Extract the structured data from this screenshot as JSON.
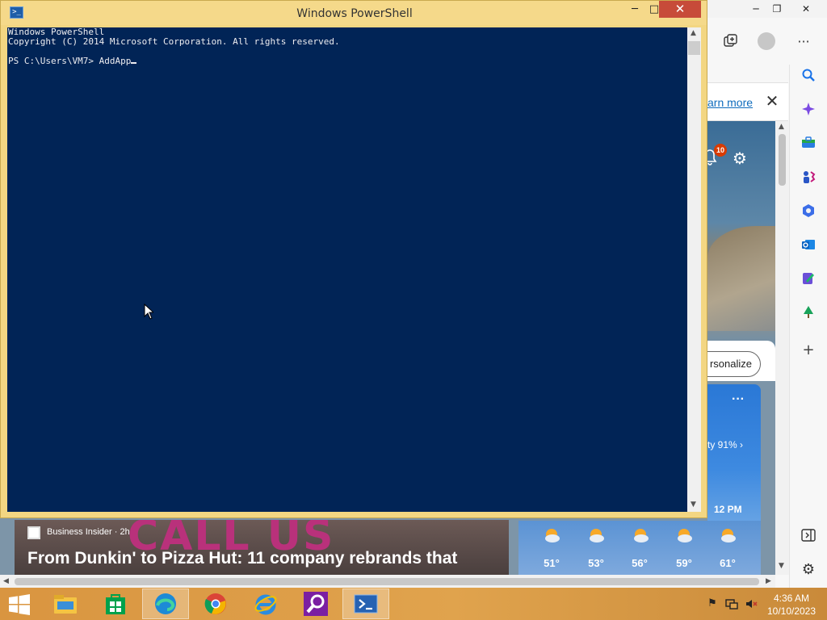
{
  "browser": {
    "window_controls": {
      "minimize": "─",
      "maximize": "❐",
      "close": "✕"
    },
    "toolbar": {
      "more": "···"
    },
    "infobar": {
      "learn_more": "arn more",
      "close": "✕"
    },
    "notification_count": "10",
    "personalize_label": "rsonalize",
    "weather": {
      "more": "···",
      "humidity": "ty 91% ›",
      "time_label": "12 PM",
      "forecast": [
        "51°",
        "53°",
        "56°",
        "59°",
        "61°"
      ]
    },
    "news": {
      "image_text": "CALL US",
      "source": "Business Insider · 2h",
      "title": "From Dunkin' to Pizza Hut: 11 company rebrands that"
    }
  },
  "powershell": {
    "title": "Windows PowerShell",
    "controls": {
      "minimize": "─",
      "maximize": "□",
      "close": "✕"
    },
    "lines": [
      "Windows PowerShell",
      "Copyright (C) 2014 Microsoft Corporation. All rights reserved.",
      "",
      "PS C:\\Users\\VM7> AddApp"
    ],
    "colors": {
      "background": "#012456",
      "foreground": "#eeedf0"
    }
  },
  "taskbar": {
    "apps": [
      "Start",
      "File Explorer",
      "Store",
      "Microsoft Edge",
      "Google Chrome",
      "Internet Explorer",
      "Search Tool",
      "Windows PowerShell"
    ],
    "clock_time": "4:36 AM",
    "clock_date": "10/10/2023",
    "accent": "#d99540"
  }
}
